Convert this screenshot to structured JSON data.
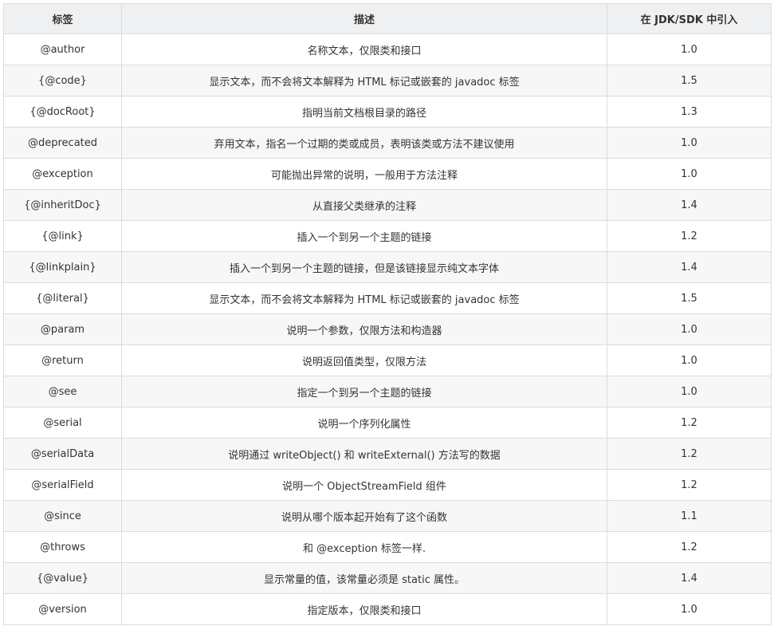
{
  "table": {
    "headers": [
      "标签",
      "描述",
      "在 JDK/SDK 中引入"
    ],
    "rows": [
      {
        "tag": "@author",
        "desc": "名称文本，仅限类和接口",
        "since": "1.0"
      },
      {
        "tag": "{@code}",
        "desc": "显示文本，而不会将文本解释为 HTML 标记或嵌套的 javadoc 标签",
        "since": "1.5"
      },
      {
        "tag": "{@docRoot}",
        "desc": "指明当前文档根目录的路径",
        "since": "1.3"
      },
      {
        "tag": "@deprecated",
        "desc": "弃用文本，指名一个过期的类或成员，表明该类或方法不建议使用",
        "since": "1.0"
      },
      {
        "tag": "@exception",
        "desc": "可能抛出异常的说明，一般用于方法注释",
        "since": "1.0"
      },
      {
        "tag": "{@inheritDoc}",
        "desc": "从直接父类继承的注释",
        "since": "1.4"
      },
      {
        "tag": "{@link}",
        "desc": "插入一个到另一个主题的链接",
        "since": "1.2"
      },
      {
        "tag": "{@linkplain}",
        "desc": "插入一个到另一个主题的链接，但是该链接显示纯文本字体",
        "since": "1.4"
      },
      {
        "tag": "{@literal}",
        "desc": "显示文本，而不会将文本解释为 HTML 标记或嵌套的 javadoc 标签",
        "since": "1.5"
      },
      {
        "tag": "@param",
        "desc": "说明一个参数，仅限方法和构造器",
        "since": "1.0"
      },
      {
        "tag": "@return",
        "desc": "说明返回值类型，仅限方法",
        "since": "1.0"
      },
      {
        "tag": "@see",
        "desc": "指定一个到另一个主题的链接",
        "since": "1.0"
      },
      {
        "tag": "@serial",
        "desc": "说明一个序列化属性",
        "since": "1.2"
      },
      {
        "tag": "@serialData",
        "desc": "说明通过 writeObject() 和 writeExternal() 方法写的数据",
        "since": "1.2"
      },
      {
        "tag": "@serialField",
        "desc": "说明一个 ObjectStreamField 组件",
        "since": "1.2"
      },
      {
        "tag": "@since",
        "desc": "说明从哪个版本起开始有了这个函数",
        "since": "1.1"
      },
      {
        "tag": "@throws",
        "desc": "和 @exception 标签一样.",
        "since": "1.2"
      },
      {
        "tag": "{@value}",
        "desc": "显示常量的值，该常量必须是 static 属性。",
        "since": "1.4"
      },
      {
        "tag": "@version",
        "desc": "指定版本，仅限类和接口",
        "since": "1.0"
      }
    ]
  }
}
